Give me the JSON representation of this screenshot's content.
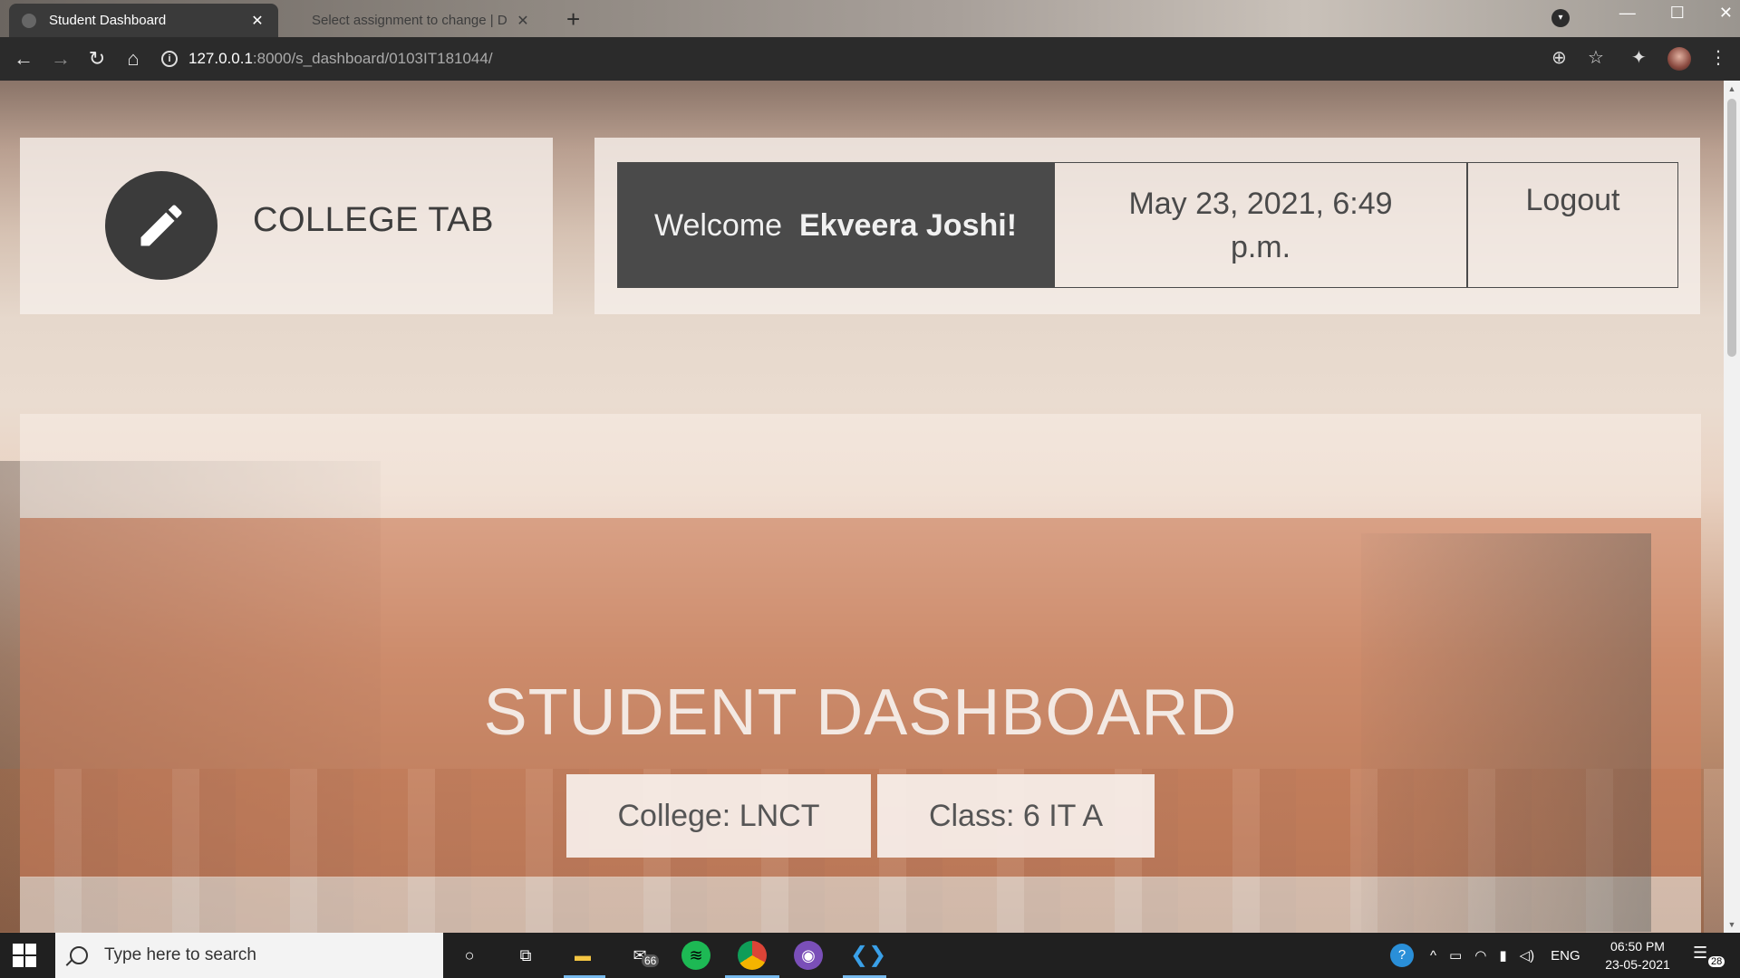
{
  "browser": {
    "tabs": [
      {
        "title": "Student Dashboard",
        "active": true
      },
      {
        "title": "Select assignment to change | D",
        "active": false
      }
    ],
    "url_host": "127.0.0.1",
    "url_path": ":8000/s_dashboard/0103IT181044/"
  },
  "header": {
    "brand": "COLLEGE TAB",
    "welcome_prefix": "Welcome",
    "user_name": "Ekveera Joshi!",
    "datetime": "May 23, 2021, 6:49 p.m.",
    "logout_label": "Logout"
  },
  "dashboard": {
    "title": "STUDENT DASHBOARD",
    "college": "College: LNCT",
    "class": "Class: 6 IT A"
  },
  "taskbar": {
    "search_placeholder": "Type here to search",
    "mail_badge": "66",
    "language": "ENG",
    "time": "06:50 PM",
    "date": "23-05-2021",
    "notification_count": "28"
  },
  "colors": {
    "dark_panel": "#4a4a4a",
    "accent_band": "#d0805c",
    "taskbar": "#202020"
  }
}
